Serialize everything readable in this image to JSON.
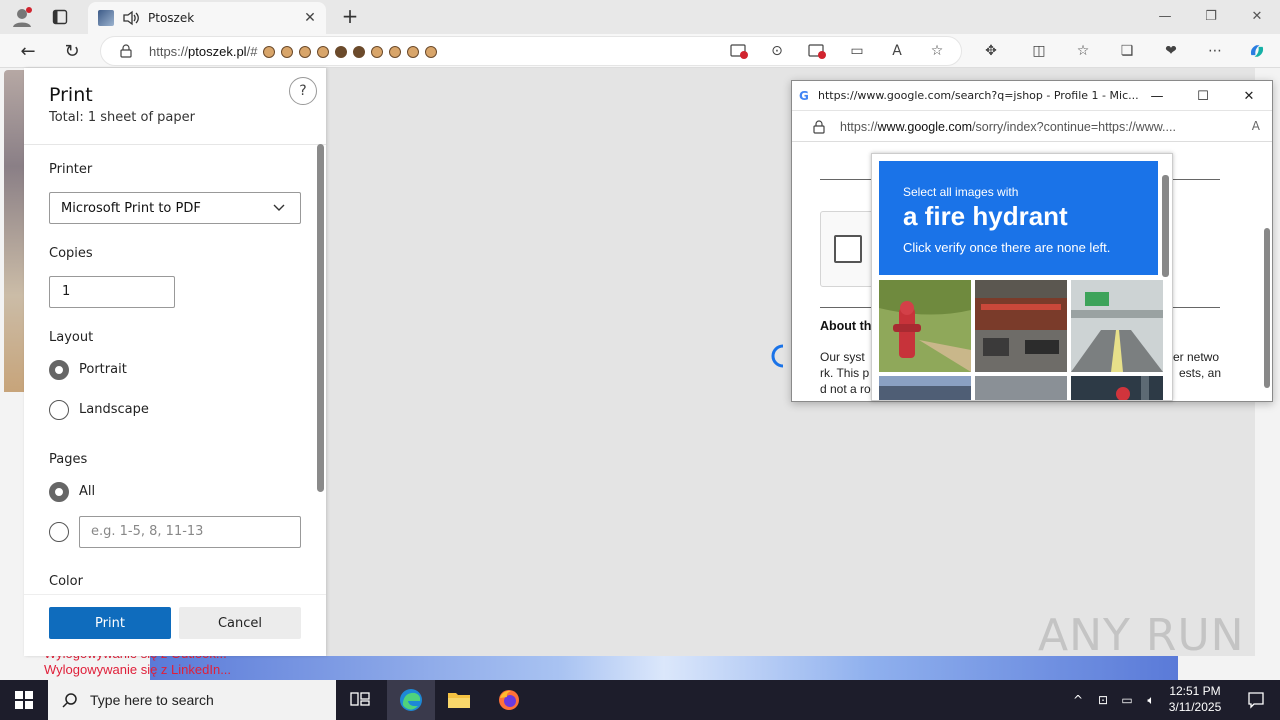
{
  "browser": {
    "tab_title": "Ptoszek",
    "url_prefix": "https://",
    "url_domain": "ptoszek.pl",
    "url_rest": "/#"
  },
  "print": {
    "title": "Print",
    "total": "Total: 1 sheet of paper",
    "help": "?",
    "printer_label": "Printer",
    "printer_value": "Microsoft Print to PDF",
    "copies_label": "Copies",
    "copies_value": "1",
    "layout_label": "Layout",
    "portrait": "Portrait",
    "landscape": "Landscape",
    "pages_label": "Pages",
    "all": "All",
    "pages_placeholder": "e.g. 1-5, 8, 11-13",
    "color_label": "Color",
    "print_button": "Print",
    "cancel_button": "Cancel"
  },
  "page": {
    "link1": "Wylogowywanie się z Outlook...",
    "link2": "Wylogowywanie się z LinkedIn..."
  },
  "popup": {
    "title": "https://www.google.com/search?q=jshop - Profile 1 - Mic...",
    "url_prefix": "https://",
    "url_domain": "www.google.com",
    "url_rest": "/sorry/index?continue=https://www....",
    "about": "About th",
    "text_line1": "Our syst",
    "text_line2": "rk. This p",
    "text_line3": "d not a ro",
    "text_right1": "er netwo",
    "text_right2": "ests, an"
  },
  "captcha": {
    "line1": "Select all images with",
    "line2": "a fire hydrant",
    "line3": "Click verify once there are none left."
  },
  "watermark": "ANY RUN",
  "taskbar": {
    "search_placeholder": "Type here to search",
    "time": "12:51 PM",
    "date": "3/11/2025"
  }
}
